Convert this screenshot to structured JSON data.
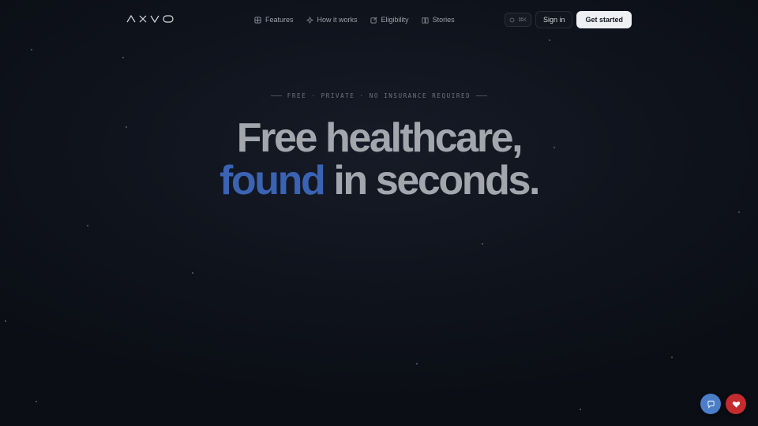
{
  "brand": {
    "logo_text": "AXVO"
  },
  "nav": {
    "links": [
      {
        "label": "Features",
        "icon": "grid-icon"
      },
      {
        "label": "How it works",
        "icon": "sparkle-icon"
      },
      {
        "label": "Eligibility",
        "icon": "edit-icon"
      },
      {
        "label": "Stories",
        "icon": "book-icon"
      }
    ],
    "search_shortcut": "⌘K",
    "signin_label": "Sign in",
    "cta_label": "Get started"
  },
  "hero": {
    "tagline": "FREE · PRIVATE · NO INSURANCE REQUIRED",
    "line1": "Free healthcare,",
    "line2_accent": "found",
    "line2_rest": " in seconds."
  },
  "floating": {
    "assistant_icon": "chat-bubble-icon",
    "favorite_icon": "heart-icon"
  },
  "colors": {
    "accent": "#3b63b3",
    "cta_bg": "#eef0f3",
    "fab_blue": "#4a7ec8",
    "fab_red": "#c42b2e",
    "background": "#0f131c"
  }
}
